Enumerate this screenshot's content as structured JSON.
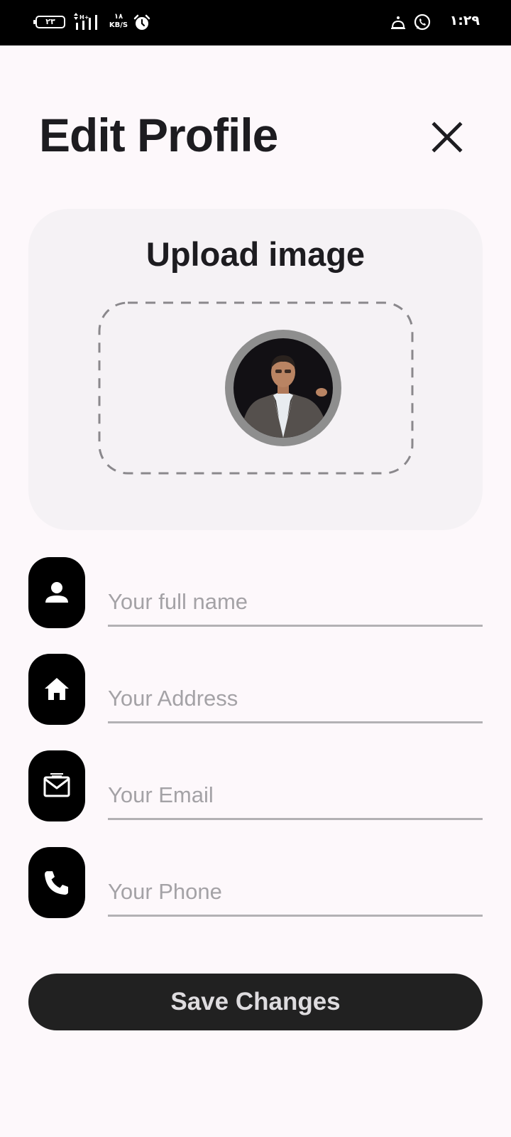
{
  "status_bar": {
    "battery": "٢٣",
    "network_speed_value": "١٨",
    "network_speed_unit": "KB/S",
    "time": "١:٢٩",
    "icons": [
      "battery-icon",
      "signal-icon",
      "alarm-icon",
      "notification-icon",
      "whatsapp-icon"
    ]
  },
  "header": {
    "title": "Edit Profile",
    "close_icon": "close-icon"
  },
  "upload": {
    "title": "Upload image",
    "avatar": "profile-photo"
  },
  "form": {
    "name": {
      "icon": "person-icon",
      "placeholder": "Your full name",
      "value": ""
    },
    "address": {
      "icon": "home-icon",
      "placeholder": "Your Address",
      "value": ""
    },
    "email": {
      "icon": "mail-icon",
      "placeholder": "Your Email",
      "value": ""
    },
    "phone": {
      "icon": "phone-icon",
      "placeholder": "Your Phone",
      "value": ""
    }
  },
  "actions": {
    "save_label": "Save Changes"
  },
  "colors": {
    "background": "#fdf8fb",
    "card": "#f5f2f5",
    "icon_tile": "#000000",
    "button": "#212121",
    "button_text": "#dedcdf",
    "placeholder": "#a4a2a6",
    "underline": "#b3b1b4"
  }
}
